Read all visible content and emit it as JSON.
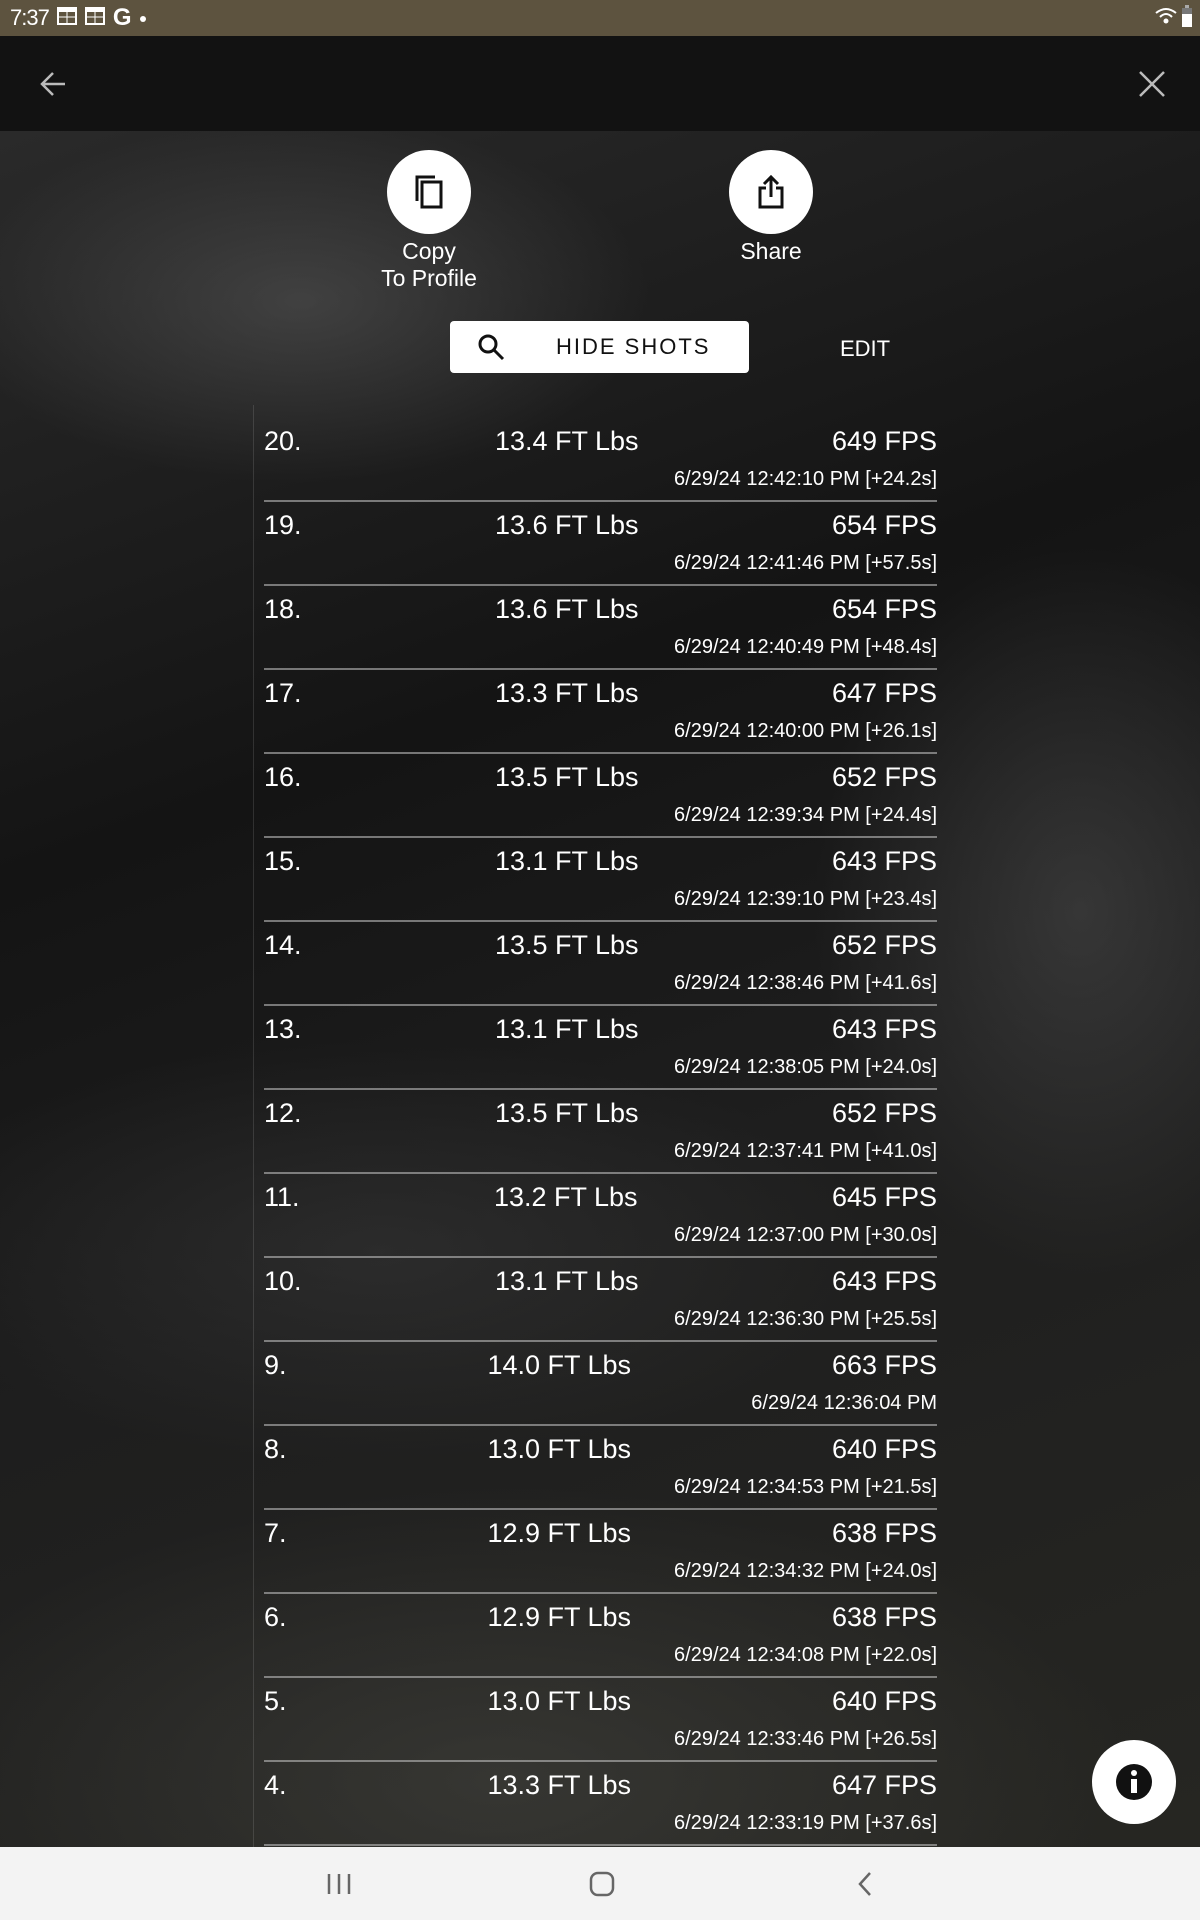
{
  "status_bar": {
    "time": "7:37",
    "icons": [
      "calendar-icon",
      "calendar-icon",
      "google-icon",
      "dot-icon",
      "wifi-icon",
      "battery-icon"
    ]
  },
  "header": {
    "back_icon": "arrow-left-icon",
    "close_icon": "close-icon"
  },
  "actions": {
    "copy": {
      "icon": "copy-icon",
      "label_line1": "Copy",
      "label_line2": "To Profile"
    },
    "share": {
      "icon": "share-icon",
      "label": "Share"
    }
  },
  "toolbar": {
    "hide_shots_label": "HIDE SHOTS",
    "search_icon": "search-icon",
    "edit_label": "EDIT"
  },
  "shots": [
    {
      "num": "20.",
      "energy": "13.4 FT Lbs",
      "fps": "649 FPS",
      "date": "6/29/24 12:42:10 PM [+24.2s]"
    },
    {
      "num": "19.",
      "energy": "13.6 FT Lbs",
      "fps": "654 FPS",
      "date": "6/29/24 12:41:46 PM [+57.5s]"
    },
    {
      "num": "18.",
      "energy": "13.6 FT Lbs",
      "fps": "654 FPS",
      "date": "6/29/24 12:40:49 PM [+48.4s]"
    },
    {
      "num": "17.",
      "energy": "13.3 FT Lbs",
      "fps": "647 FPS",
      "date": "6/29/24 12:40:00 PM [+26.1s]"
    },
    {
      "num": "16.",
      "energy": "13.5 FT Lbs",
      "fps": "652 FPS",
      "date": "6/29/24 12:39:34 PM [+24.4s]"
    },
    {
      "num": "15.",
      "energy": "13.1 FT Lbs",
      "fps": "643 FPS",
      "date": "6/29/24 12:39:10 PM [+23.4s]"
    },
    {
      "num": "14.",
      "energy": "13.5 FT Lbs",
      "fps": "652 FPS",
      "date": "6/29/24 12:38:46 PM [+41.6s]"
    },
    {
      "num": "13.",
      "energy": "13.1 FT Lbs",
      "fps": "643 FPS",
      "date": "6/29/24 12:38:05 PM [+24.0s]"
    },
    {
      "num": "12.",
      "energy": "13.5 FT Lbs",
      "fps": "652 FPS",
      "date": "6/29/24 12:37:41 PM [+41.0s]"
    },
    {
      "num": "11.",
      "energy": "13.2 FT Lbs",
      "fps": "645 FPS",
      "date": "6/29/24 12:37:00 PM [+30.0s]"
    },
    {
      "num": "10.",
      "energy": "13.1 FT Lbs",
      "fps": "643 FPS",
      "date": "6/29/24 12:36:30 PM [+25.5s]"
    },
    {
      "num": "9.",
      "energy": "14.0 FT Lbs",
      "fps": "663 FPS",
      "date": "6/29/24 12:36:04 PM"
    },
    {
      "num": "8.",
      "energy": "13.0 FT Lbs",
      "fps": "640 FPS",
      "date": "6/29/24 12:34:53 PM [+21.5s]"
    },
    {
      "num": "7.",
      "energy": "12.9 FT Lbs",
      "fps": "638 FPS",
      "date": "6/29/24 12:34:32 PM [+24.0s]"
    },
    {
      "num": "6.",
      "energy": "12.9 FT Lbs",
      "fps": "638 FPS",
      "date": "6/29/24 12:34:08 PM [+22.0s]"
    },
    {
      "num": "5.",
      "energy": "13.0 FT Lbs",
      "fps": "640 FPS",
      "date": "6/29/24 12:33:46 PM [+26.5s]"
    },
    {
      "num": "4.",
      "energy": "13.3 FT Lbs",
      "fps": "647 FPS",
      "date": "6/29/24 12:33:19 PM [+37.6s]"
    }
  ],
  "info_button": {
    "icon": "info-icon"
  },
  "nav_bar": {
    "icons": [
      "recent-apps-icon",
      "home-icon",
      "back-icon"
    ]
  }
}
